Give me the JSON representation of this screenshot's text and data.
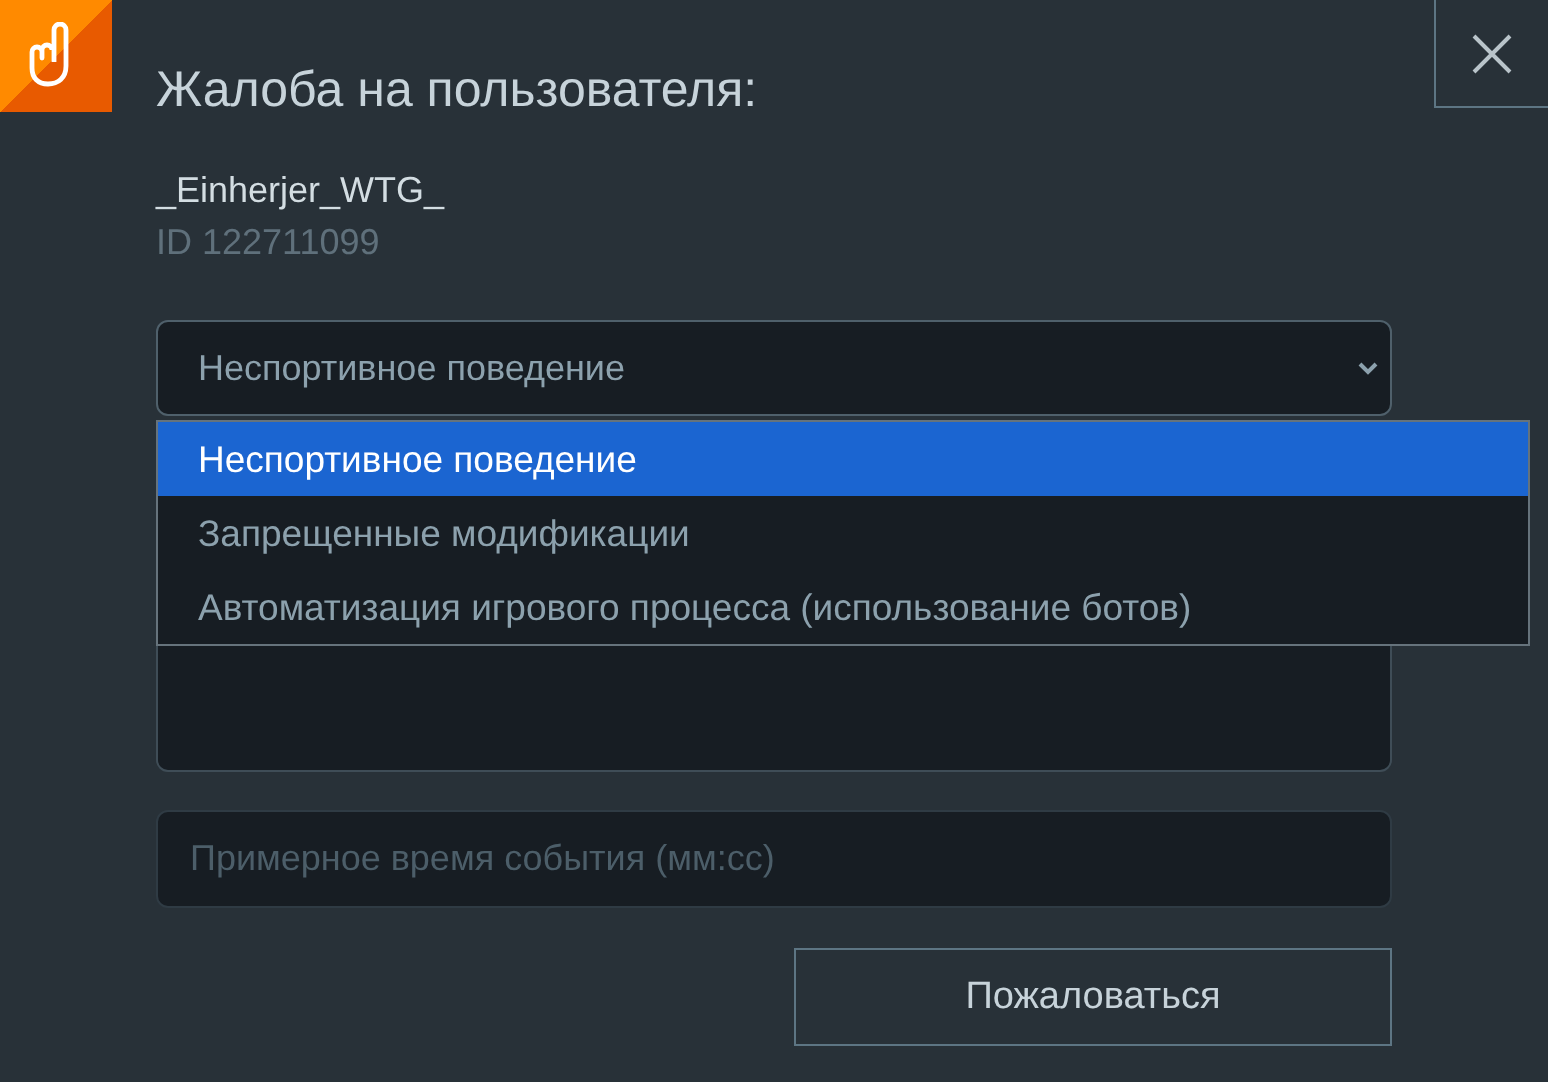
{
  "dialog": {
    "title": "Жалоба на пользователя:",
    "user_name": "_Einherjer_WTG_",
    "user_id": "ID 122711099"
  },
  "reason_select": {
    "value": "Неспортивное поведение",
    "expanded": true,
    "options": [
      {
        "label": "Неспортивное поведение",
        "selected": true
      },
      {
        "label": "Запрещенные модификации",
        "selected": false
      },
      {
        "label": "Автоматизация игрового процесса (использование ботов)",
        "selected": false
      }
    ]
  },
  "time_field": {
    "placeholder": "Примерное время события (мм:сс)"
  },
  "submit_button": "Пожаловаться"
}
